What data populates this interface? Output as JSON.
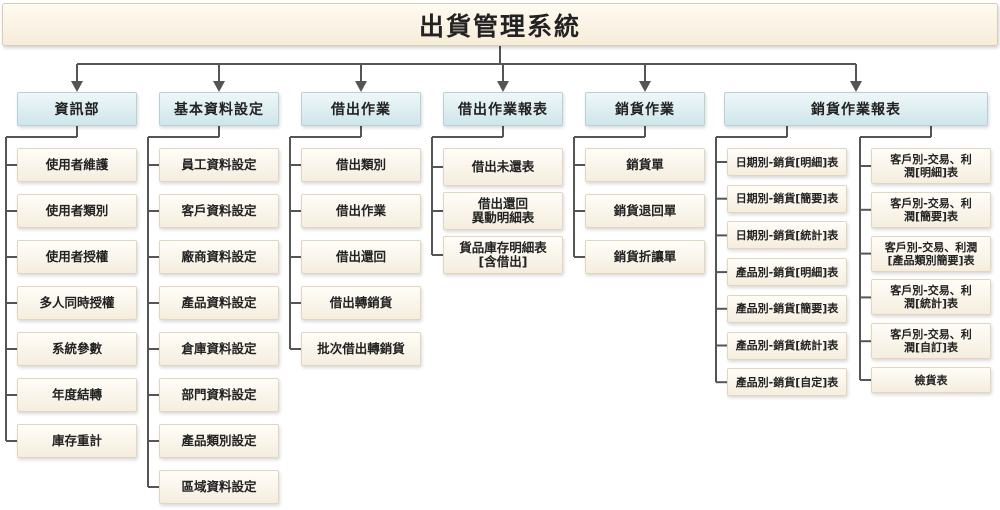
{
  "title": "出貨管理系統",
  "categories": [
    {
      "label": "資訊部",
      "items": [
        "使用者維護",
        "使用者類別",
        "使用者授權",
        "多人同時授權",
        "系統參數",
        "年度結轉",
        "庫存重計"
      ]
    },
    {
      "label": "基本資料設定",
      "items": [
        "員工資料設定",
        "客戶資料設定",
        "廠商資料設定",
        "產品資料設定",
        "倉庫資料設定",
        "部門資料設定",
        "產品類別設定",
        "區域資料設定"
      ]
    },
    {
      "label": "借出作業",
      "items": [
        "借出類別",
        "借出作業",
        "借出還回",
        "借出轉銷貨",
        "批次借出轉銷貨"
      ]
    },
    {
      "label": "借出作業報表",
      "items": [
        "借出未還表",
        "借出還回\n異動明細表",
        "貨品庫存明細表\n[含借出]"
      ]
    },
    {
      "label": "銷貨作業",
      "items": [
        "銷貨單",
        "銷貨退回單",
        "銷貨折讓單"
      ]
    },
    {
      "label": "銷貨作業報表",
      "items_left": [
        "日期別-銷貨[明細]表",
        "日期別-銷貨[簡要]表",
        "日期別-銷貨[統計]表",
        "產品別-銷貨[明細]表",
        "產品別-銷貨[簡要]表",
        "產品別-銷貨[統計]表",
        "產品別-銷貨[自定]表"
      ],
      "items_right": [
        "客戶別-交易、利\n潤[明細]表",
        "客戶別-交易、利\n潤[簡要]表",
        "客戶別-交易、利潤\n[產品類別簡要]表",
        "客戶別-交易、利\n潤[統計]表",
        "客戶別-交易、利\n潤[自訂]表",
        "檢貨表"
      ]
    }
  ],
  "colors": {
    "line": "#555555",
    "arrow": "#555555"
  }
}
